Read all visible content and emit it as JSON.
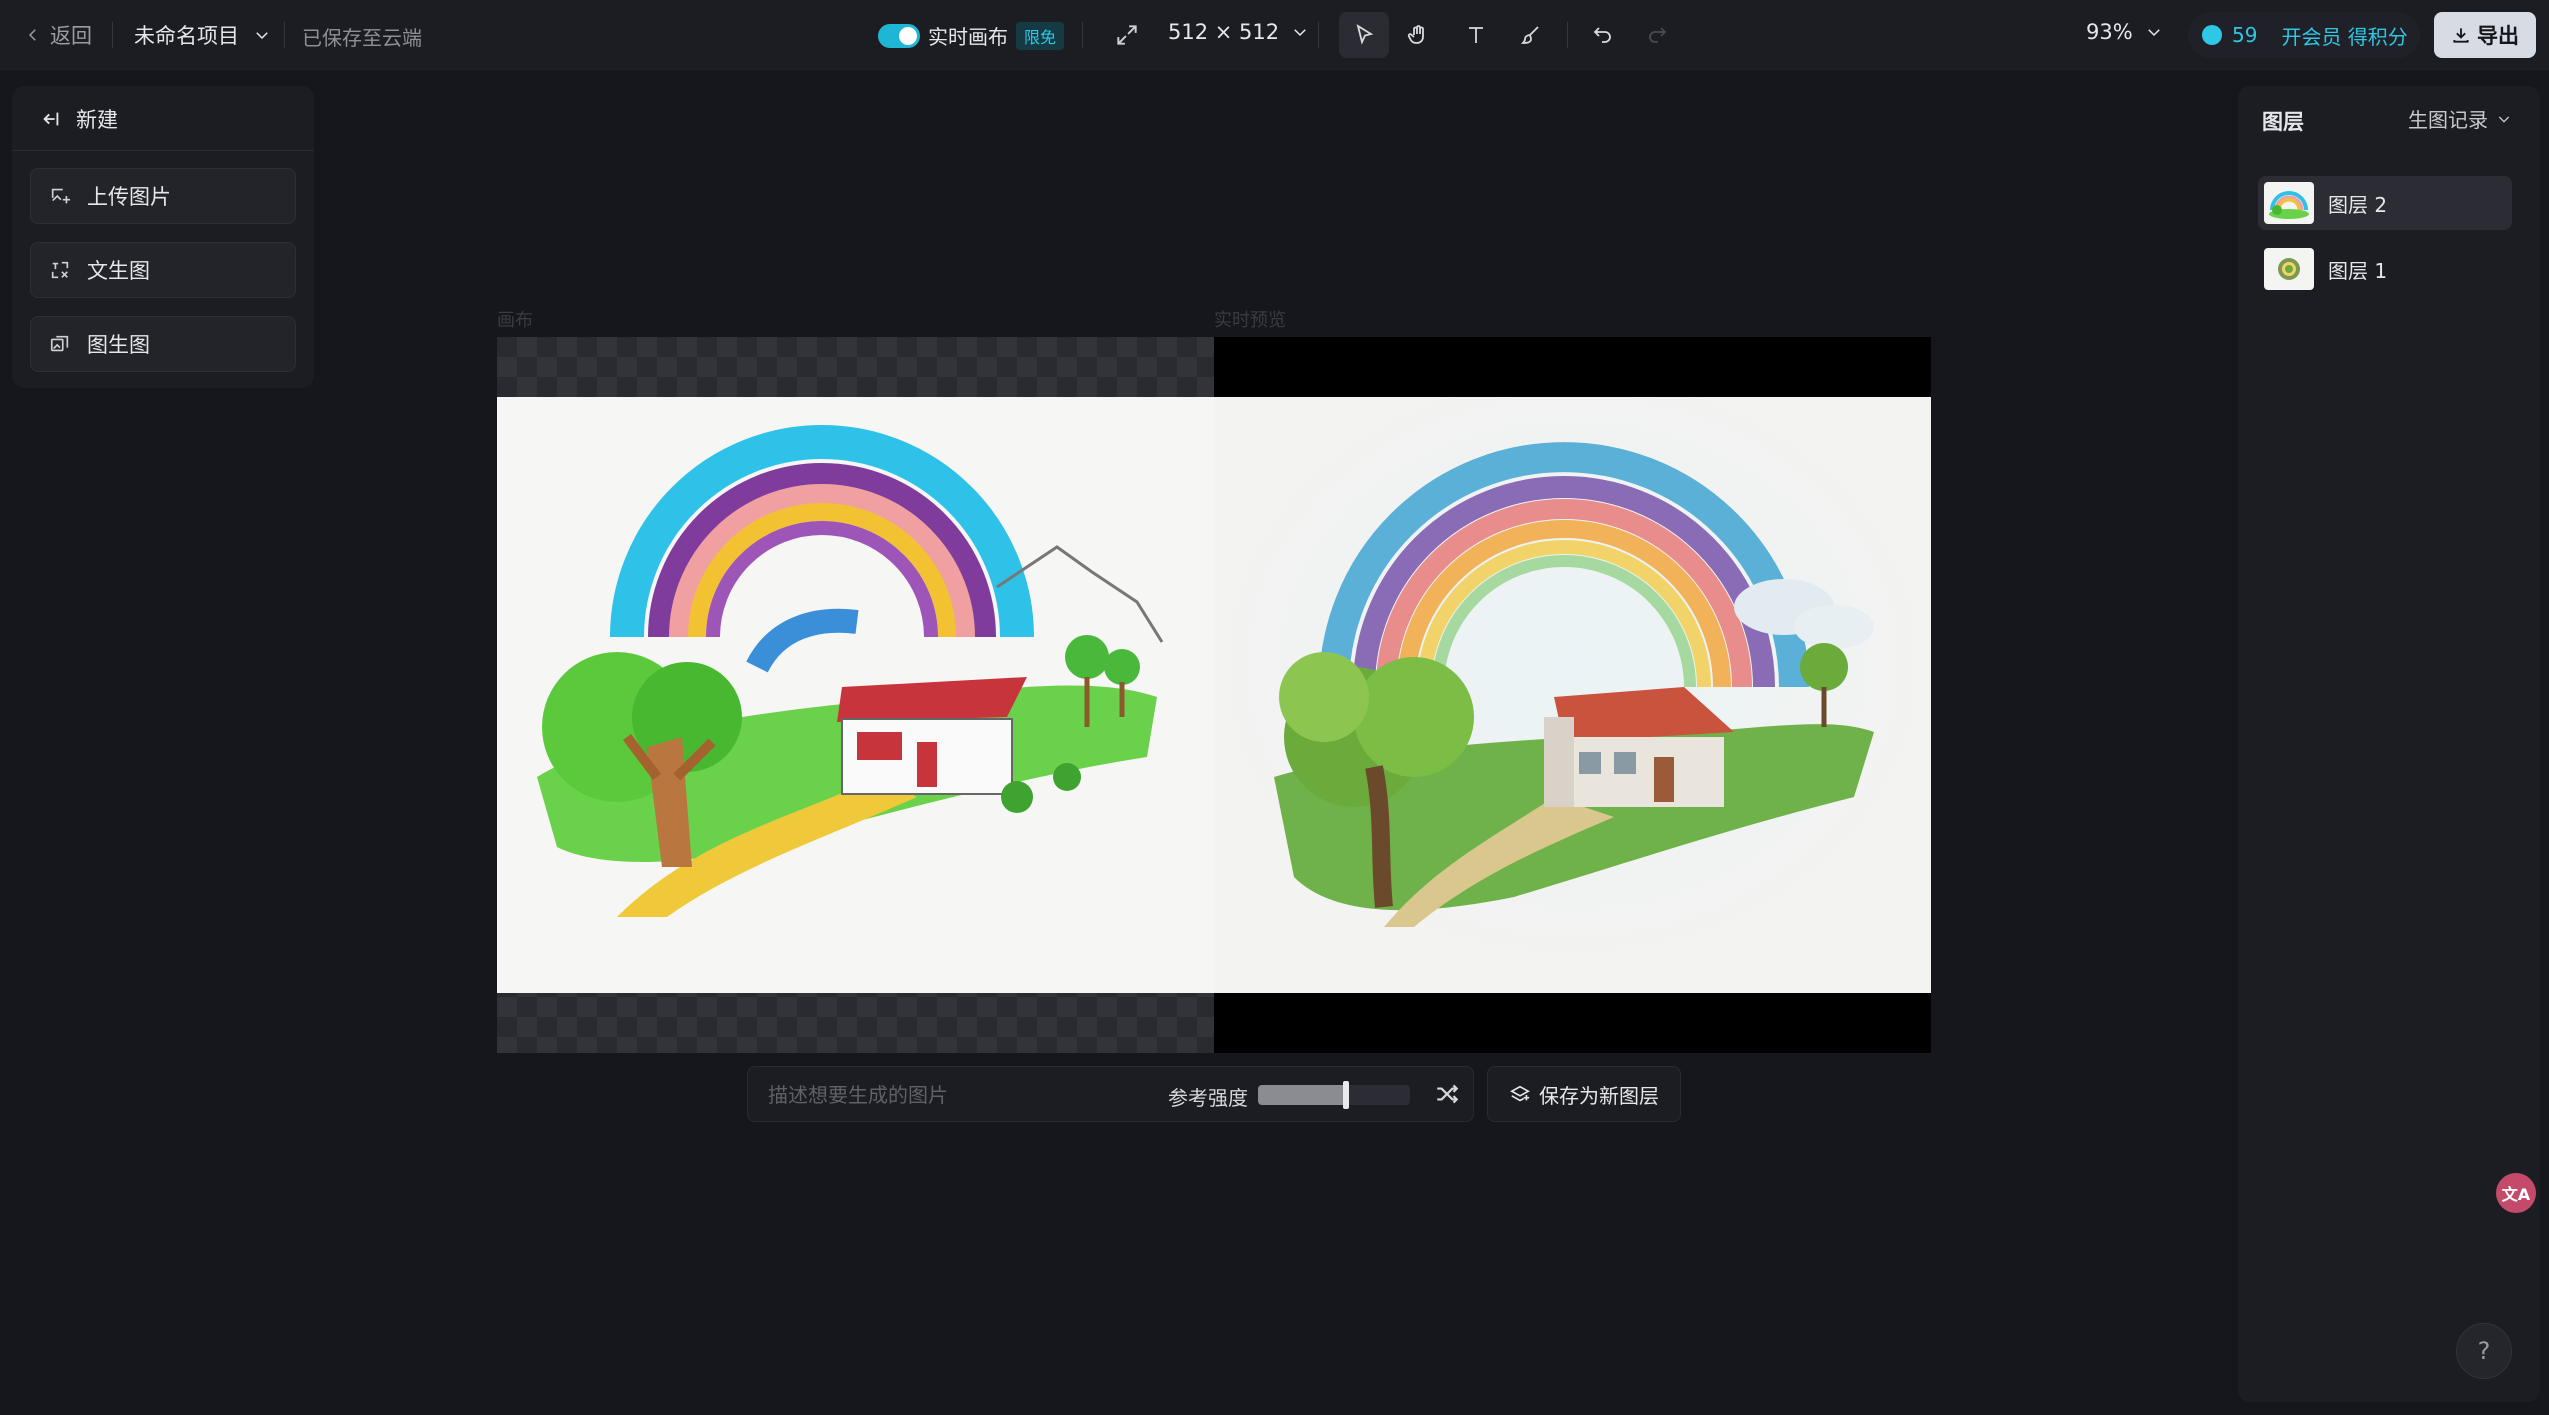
{
  "topbar": {
    "back_label": "返回",
    "project_name": "未命名项目",
    "save_status": "已保存至云端",
    "realtime_label": "实时画布",
    "realtime_badge": "限免",
    "canvas_size": "512 × 512",
    "zoom": "93%",
    "credits": "59",
    "vip_label": "开会员 得积分",
    "export_label": "导出"
  },
  "left_panel": {
    "header": "新建",
    "items": [
      {
        "label": "上传图片",
        "icon": "upload-image-icon"
      },
      {
        "label": "文生图",
        "icon": "text-to-image-icon"
      },
      {
        "label": "图生图",
        "icon": "image-to-image-icon"
      }
    ]
  },
  "canvas": {
    "left_label": "画布",
    "right_label": "实时预览"
  },
  "prompt": {
    "placeholder": "描述想要生成的图片",
    "strength_label": "参考强度",
    "strength_value": 0.58,
    "save_layer_label": "保存为新图层"
  },
  "right_panel": {
    "title": "图层",
    "history_label": "生图记录",
    "layers": [
      {
        "name": "图层 2",
        "active": true
      },
      {
        "name": "图层 1",
        "active": false
      }
    ]
  },
  "floating": {
    "translate_label": "文A",
    "help_label": "?"
  },
  "colors": {
    "accent": "#2ec7e5",
    "background": "#16171c",
    "panel": "#1c1d22",
    "translate": "#c44a6a"
  }
}
